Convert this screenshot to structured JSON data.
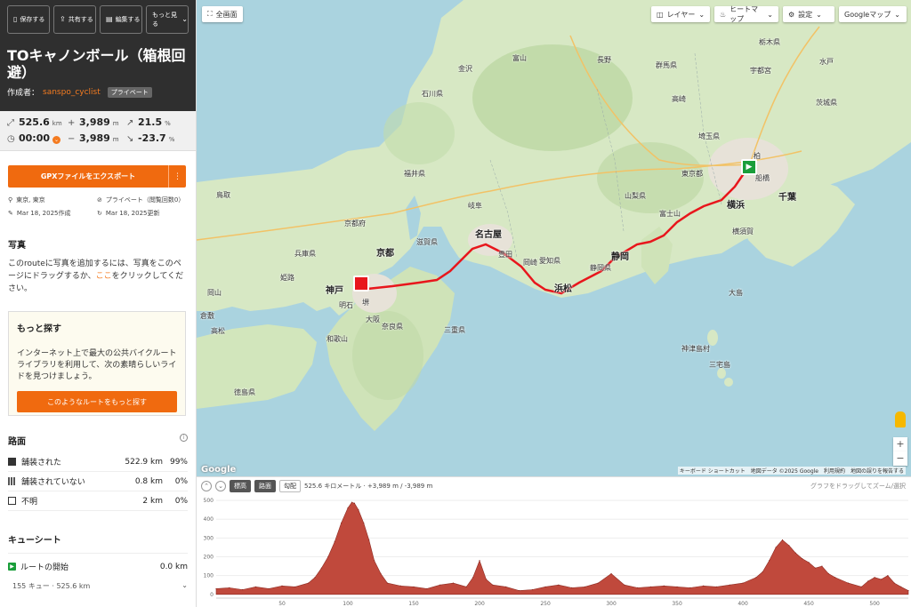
{
  "toolbar": [
    {
      "label": "保存する",
      "icon": "bookmark-icon"
    },
    {
      "label": "共有する",
      "icon": "share-icon"
    },
    {
      "label": "編集する",
      "icon": "edit-icon"
    },
    {
      "label": "もっと見る",
      "icon": "more-icon"
    }
  ],
  "route": {
    "title": "TOキャノンボール（箱根回避）",
    "creator_prefix": "作成者：",
    "creator": "sanspo_cyclist",
    "privacy_badge": "プライベート"
  },
  "stats": {
    "distance": "525.6",
    "distance_unit": "km",
    "elev_gain": "3,989",
    "elev_gain_unit": "m",
    "max_grade": "21.5",
    "max_grade_unit": "%",
    "time": "00:00",
    "elev_loss": "3,989",
    "elev_loss_unit": "m",
    "min_grade": "-23.7",
    "min_grade_unit": "%"
  },
  "export": {
    "label": "GPXファイルをエクスポート",
    "more": "⋮"
  },
  "meta": {
    "location": "東京, 東京",
    "visibility": "プライベート（閲覧回数0）",
    "created": "Mar 18, 2025作成",
    "updated": "Mar 18, 2025更新"
  },
  "photos": {
    "heading": "写真",
    "text_before": "このrouteに写真を追加するには、写真をこのページにドラッグするか、",
    "link": "ここ",
    "text_after": "をクリックしてください。"
  },
  "more": {
    "heading": "もっと探す",
    "text": "インターネット上で最大の公共バイクルートライブラリを利用して、次の素晴らしいライドを見つけましょう。",
    "button": "このようなルートをもっと探す"
  },
  "surface": {
    "heading": "路面",
    "rows": [
      {
        "label": "舗装された",
        "km": "522.9 km",
        "pct": "99%",
        "color": "#333333"
      },
      {
        "label": "舗装されていない",
        "km": "0.8 km",
        "pct": "0%",
        "color": "#666666"
      },
      {
        "label": "不明",
        "km": "2 km",
        "pct": "0%",
        "color": "#ffffff"
      }
    ]
  },
  "cue": {
    "heading": "キューシート",
    "start_label": "ルートの開始",
    "start_km": "0.0 km",
    "summary": "155 キュー · 525.6 km"
  },
  "map": {
    "fullscreen": "全画面",
    "layers": "レイヤー",
    "heatmap": "ヒートマップ",
    "settings": "設定",
    "maptype": "Googleマップ",
    "google": "Google",
    "footer": "キーボード ショートカット　地図データ ©2025 Google　利用規約　地図の誤りを報告する",
    "zoom_in": "+",
    "zoom_out": "−",
    "places": [
      {
        "t": "名古屋",
        "big": true
      },
      {
        "t": "京都",
        "big": true
      },
      {
        "t": "神戸",
        "big": true
      },
      {
        "t": "横浜",
        "big": true
      },
      {
        "t": "浜松",
        "big": true
      },
      {
        "t": "静岡",
        "big": true
      },
      {
        "t": "千葉",
        "big": true
      },
      {
        "t": "岐阜",
        "big": false
      },
      {
        "t": "長野",
        "big": false
      },
      {
        "t": "金沢",
        "big": false
      },
      {
        "t": "富山",
        "big": false
      },
      {
        "t": "高崎",
        "big": false
      },
      {
        "t": "宇都宮",
        "big": false
      },
      {
        "t": "水戸",
        "big": false
      },
      {
        "t": "鳥取",
        "big": false
      },
      {
        "t": "岡山",
        "big": false
      },
      {
        "t": "姫路",
        "big": false
      },
      {
        "t": "和歌山",
        "big": false
      },
      {
        "t": "奈良県",
        "big": false
      },
      {
        "t": "三重県",
        "big": false
      },
      {
        "t": "滋賀県",
        "big": false
      },
      {
        "t": "福井県",
        "big": false
      },
      {
        "t": "石川県",
        "big": false
      },
      {
        "t": "山梨県",
        "big": false
      },
      {
        "t": "埼玉県",
        "big": false
      },
      {
        "t": "東京都",
        "big": false
      },
      {
        "t": "群馬県",
        "big": false
      },
      {
        "t": "栃木県",
        "big": false
      },
      {
        "t": "茨城県",
        "big": false
      },
      {
        "t": "静岡県",
        "big": false
      },
      {
        "t": "愛知県",
        "big": false
      },
      {
        "t": "兵庫県",
        "big": false
      },
      {
        "t": "京都府",
        "big": false
      },
      {
        "t": "大阪",
        "big": false
      },
      {
        "t": "堺",
        "big": false
      },
      {
        "t": "明石",
        "big": false
      },
      {
        "t": "徳島県",
        "big": false
      },
      {
        "t": "高松",
        "big": false
      },
      {
        "t": "倉敷",
        "big": false
      },
      {
        "t": "豊田",
        "big": false
      },
      {
        "t": "岡崎",
        "big": false
      },
      {
        "t": "富士山",
        "big": false
      },
      {
        "t": "横須賀",
        "big": false
      },
      {
        "t": "船橋",
        "big": false
      },
      {
        "t": "柏",
        "big": false
      },
      {
        "t": "三宅島",
        "big": false
      },
      {
        "t": "神津島村",
        "big": false
      },
      {
        "t": "大島",
        "big": false
      }
    ]
  },
  "elevation": {
    "chips": [
      "標高",
      "路面",
      "勾配"
    ],
    "summary": "525.6 キロメートル · +3,989 m / -3,989 m",
    "hint": "グラフをドラッグしてズーム/選択",
    "y_ticks": [
      "500",
      "400",
      "300",
      "200",
      "100",
      "0"
    ],
    "x_ticks": [
      "50",
      "100",
      "150",
      "200",
      "250",
      "300",
      "350",
      "400",
      "450",
      "500"
    ]
  },
  "chart_data": {
    "type": "area",
    "xlabel": "",
    "ylabel": "",
    "xlim": [
      0,
      525.6
    ],
    "ylim": [
      -20,
      510
    ],
    "x": [
      0,
      10,
      20,
      30,
      40,
      50,
      60,
      70,
      75,
      80,
      85,
      90,
      95,
      100,
      103,
      105,
      108,
      112,
      116,
      120,
      125,
      130,
      140,
      150,
      160,
      170,
      180,
      190,
      195,
      200,
      205,
      210,
      220,
      230,
      240,
      250,
      260,
      270,
      280,
      290,
      300,
      310,
      320,
      330,
      340,
      350,
      360,
      370,
      380,
      390,
      400,
      410,
      415,
      420,
      425,
      430,
      435,
      440,
      445,
      450,
      455,
      460,
      465,
      470,
      480,
      490,
      495,
      500,
      505,
      510,
      515,
      520,
      525.6
    ],
    "values": [
      30,
      35,
      25,
      40,
      30,
      45,
      40,
      60,
      90,
      140,
      200,
      280,
      380,
      460,
      490,
      485,
      450,
      380,
      290,
      180,
      110,
      60,
      45,
      40,
      30,
      50,
      60,
      40,
      90,
      180,
      80,
      50,
      40,
      20,
      25,
      40,
      50,
      35,
      40,
      60,
      110,
      50,
      35,
      40,
      45,
      40,
      35,
      45,
      40,
      50,
      60,
      90,
      120,
      180,
      250,
      290,
      260,
      220,
      190,
      170,
      140,
      150,
      110,
      90,
      60,
      40,
      70,
      90,
      80,
      100,
      60,
      40,
      20
    ]
  }
}
